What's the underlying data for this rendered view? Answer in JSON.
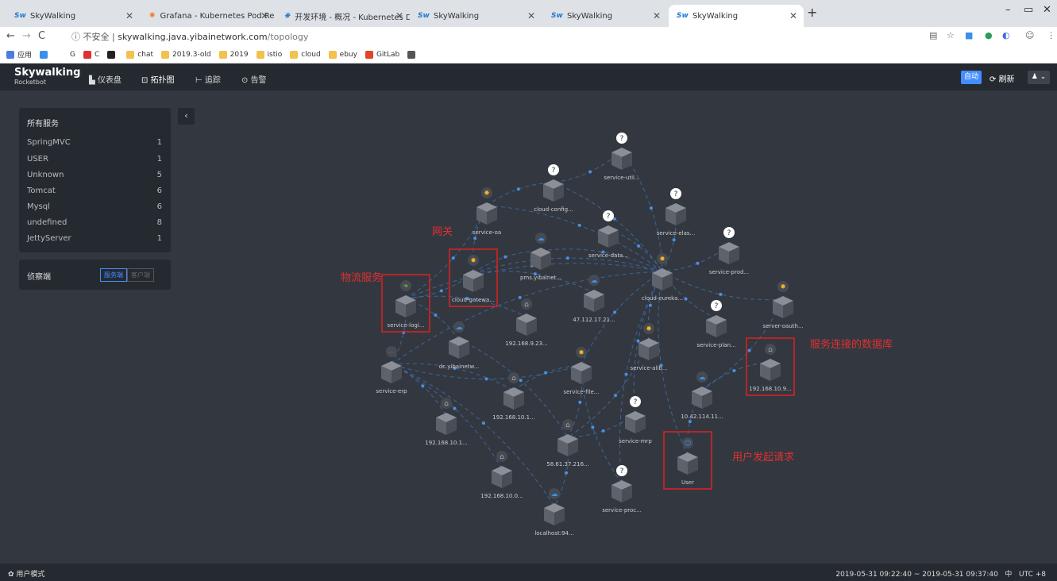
{
  "browser": {
    "tabs": [
      {
        "label": "SkyWalking",
        "icon": "skywalking-icon"
      },
      {
        "label": "Grafana - Kubernetes Pod Res",
        "icon": "grafana-icon"
      },
      {
        "label": "开发环境 - 概况 - Kubernetes D",
        "icon": "kubernetes-icon"
      },
      {
        "label": "SkyWalking",
        "icon": "skywalking-icon"
      },
      {
        "label": "SkyWalking",
        "icon": "skywalking-icon"
      },
      {
        "label": "SkyWalking",
        "icon": "skywalking-icon"
      }
    ],
    "insecure_label": "不安全",
    "url_host": "skywalking.java.yibainetwork.com",
    "url_path": "/topology",
    "bookmarks": [
      {
        "label": "应用",
        "color": "#4a7de0"
      },
      {
        "label": "",
        "color": "#3b8eea"
      },
      {
        "label": "G",
        "color": "#fff"
      },
      {
        "label": "C",
        "color": "#e03030"
      },
      {
        "label": "",
        "color": "#222"
      },
      {
        "label": "chat",
        "color": "#f2c14e"
      },
      {
        "label": "2019.3-old",
        "color": "#f2c14e"
      },
      {
        "label": "2019",
        "color": "#f2c14e"
      },
      {
        "label": "istio",
        "color": "#f2c14e"
      },
      {
        "label": "cloud",
        "color": "#f2c14e"
      },
      {
        "label": "ebuy",
        "color": "#f2c14e"
      },
      {
        "label": "GitLab",
        "color": "#e24329"
      },
      {
        "label": "",
        "color": "#555"
      }
    ]
  },
  "app": {
    "logo": "Skywalking",
    "logo_sub": "Rocketbot",
    "nav": [
      {
        "label": "仪表盘",
        "icon": "dashboard-icon"
      },
      {
        "label": "拓扑图",
        "icon": "topology-icon"
      },
      {
        "label": "追踪",
        "icon": "trace-icon"
      },
      {
        "label": "告警",
        "icon": "alarm-icon"
      }
    ],
    "auto_label": "自动",
    "refresh_label": "刷新",
    "services_title": "所有服务",
    "services": [
      {
        "name": "SpringMVC",
        "count": "1"
      },
      {
        "name": "USER",
        "count": "1"
      },
      {
        "name": "Unknown",
        "count": "5"
      },
      {
        "name": "Tomcat",
        "count": "6"
      },
      {
        "name": "Mysql",
        "count": "6"
      },
      {
        "name": "undefined",
        "count": "8"
      },
      {
        "name": "JettyServer",
        "count": "1"
      }
    ],
    "detect_label": "侦察端",
    "detect_server": "服务端",
    "detect_client": "客户端",
    "user_mode": "用户模式",
    "time_range": "2019-05-31 09:22:40 ~ 2019-05-31 09:37:40",
    "lang": "中",
    "timezone": "UTC +8"
  },
  "topology": {
    "nodes": [
      {
        "id": "service-util",
        "label": "service-util...",
        "icon": "unknown"
      },
      {
        "id": "cloud-config",
        "label": "cloud-config...",
        "icon": "unknown"
      },
      {
        "id": "service-elas",
        "label": "service-elas...",
        "icon": "unknown"
      },
      {
        "id": "service-oa",
        "label": "service-oa",
        "icon": "tomcat"
      },
      {
        "id": "service-data",
        "label": "service-data...",
        "icon": "unknown"
      },
      {
        "id": "pms",
        "label": "pms.yibainet...",
        "icon": "cloud"
      },
      {
        "id": "cloud-gateway",
        "label": "cloud-gatewa...",
        "icon": "tomcat"
      },
      {
        "id": "cloud-eureka",
        "label": "cloud-eureka...",
        "icon": "tomcat"
      },
      {
        "id": "service-prod",
        "label": "service-prod...",
        "icon": "unknown"
      },
      {
        "id": "service-logi",
        "label": "service-logi...",
        "icon": "springmvc"
      },
      {
        "id": "ip-47",
        "label": "47.112.17.21...",
        "icon": "cloud"
      },
      {
        "id": "server-oauth",
        "label": "server-oauth...",
        "icon": "tomcat"
      },
      {
        "id": "ip-192-9-23",
        "label": "192.168.9.23...",
        "icon": "mysql"
      },
      {
        "id": "service-plan",
        "label": "service-plan...",
        "icon": "unknown"
      },
      {
        "id": "dc",
        "label": "dc.yibainetw...",
        "icon": "cloud"
      },
      {
        "id": "service-alib",
        "label": "service-alib...",
        "icon": "tomcat"
      },
      {
        "id": "ip-192-10-9",
        "label": "192.168.10.9...",
        "icon": "mysql"
      },
      {
        "id": "service-erp",
        "label": "service-erp",
        "icon": "jetty"
      },
      {
        "id": "service-file",
        "label": "service-file...",
        "icon": "tomcat"
      },
      {
        "id": "ip-192-10-1a",
        "label": "192.168.10.1...",
        "icon": "mysql"
      },
      {
        "id": "ip-10-42",
        "label": "10.42.114.11...",
        "icon": "cloud"
      },
      {
        "id": "ip-192-10-1b",
        "label": "192.168.10.1...",
        "icon": "mysql"
      },
      {
        "id": "service-mrp",
        "label": "service-mrp",
        "icon": "unknown"
      },
      {
        "id": "ip-58",
        "label": "58.61.37.216...",
        "icon": "mysql"
      },
      {
        "id": "user",
        "label": "User",
        "icon": "user"
      },
      {
        "id": "ip-192-10-0",
        "label": "192.168.10.0...",
        "icon": "mysql"
      },
      {
        "id": "service-proc",
        "label": "service-proc...",
        "icon": "unknown"
      },
      {
        "id": "localhost",
        "label": "localhost:94...",
        "icon": "cloud"
      }
    ],
    "annotations": [
      {
        "text": "物流服务",
        "target": "service-logi"
      },
      {
        "text": "网关",
        "target": "cloud-gateway"
      },
      {
        "text": "服务连接的数据库",
        "target": "ip-192-10-9"
      },
      {
        "text": "用户发起请求",
        "target": "user"
      }
    ],
    "edges": [
      [
        "user",
        "ip-10-42"
      ],
      [
        "ip-10-42",
        "ip-192-10-9"
      ],
      [
        "user",
        "cloud-eureka"
      ],
      [
        "cloud-gateway",
        "cloud-eureka"
      ],
      [
        "cloud-gateway",
        "service-logi"
      ],
      [
        "cloud-gateway",
        "service-oa"
      ],
      [
        "cloud-gateway",
        "pms"
      ],
      [
        "cloud-gateway",
        "ip-47"
      ],
      [
        "service-logi",
        "service-erp"
      ],
      [
        "service-logi",
        "dc"
      ],
      [
        "service-logi",
        "ip-192-9-23"
      ],
      [
        "service-logi",
        "cloud-eureka"
      ],
      [
        "service-erp",
        "ip-192-10-1b"
      ],
      [
        "service-erp",
        "ip-192-10-1a"
      ],
      [
        "service-erp",
        "localhost"
      ],
      [
        "service-erp",
        "ip-192-10-0"
      ],
      [
        "service-oa",
        "cloud-config"
      ],
      [
        "service-oa",
        "cloud-eureka"
      ],
      [
        "service-util",
        "cloud-eureka"
      ],
      [
        "service-util",
        "cloud-config"
      ],
      [
        "service-elas",
        "cloud-eureka"
      ],
      [
        "service-data",
        "cloud-eureka"
      ],
      [
        "cloud-config",
        "cloud-eureka"
      ],
      [
        "service-prod",
        "cloud-eureka"
      ],
      [
        "server-oauth",
        "cloud-eureka"
      ],
      [
        "service-plan",
        "cloud-eureka"
      ],
      [
        "service-alib",
        "cloud-eureka"
      ],
      [
        "service-file",
        "cloud-eureka"
      ],
      [
        "service-mrp",
        "cloud-eureka"
      ],
      [
        "service-file",
        "ip-58"
      ],
      [
        "service-alib",
        "ip-58"
      ],
      [
        "ip-58",
        "localhost"
      ],
      [
        "service-proc",
        "cloud-eureka"
      ],
      [
        "service-erp",
        "cloud-eureka"
      ],
      [
        "service-file",
        "service-erp"
      ],
      [
        "pms",
        "cloud-eureka"
      ],
      [
        "dc",
        "ip-58"
      ],
      [
        "service-oa",
        "service-logi"
      ],
      [
        "ip-192-10-1a",
        "service-file"
      ],
      [
        "service-proc",
        "service-file"
      ],
      [
        "server-oauth",
        "ip-10-42"
      ],
      [
        "service-mrp",
        "ip-58"
      ]
    ]
  }
}
